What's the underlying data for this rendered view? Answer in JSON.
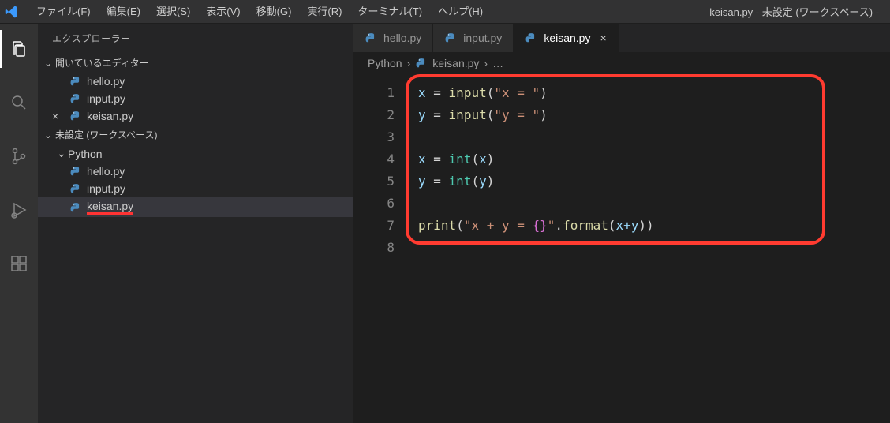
{
  "window_title": "keisan.py - 未設定 (ワークスペース) -",
  "menu": {
    "file": "ファイル(F)",
    "edit": "編集(E)",
    "select": "選択(S)",
    "view": "表示(V)",
    "go": "移動(G)",
    "run": "実行(R)",
    "terminal": "ターミナル(T)",
    "help": "ヘルプ(H)"
  },
  "sidebar": {
    "title": "エクスプローラー",
    "open_editors_label": "開いているエディター",
    "open_editors": [
      {
        "name": "hello.py"
      },
      {
        "name": "input.py"
      },
      {
        "name": "keisan.py",
        "active": true
      }
    ],
    "workspace_label": "未設定 (ワークスペース)",
    "folder": {
      "name": "Python",
      "files": [
        {
          "name": "hello.py"
        },
        {
          "name": "input.py"
        },
        {
          "name": "keisan.py",
          "selected": true
        }
      ]
    }
  },
  "tabs": [
    {
      "name": "hello.py"
    },
    {
      "name": "input.py"
    },
    {
      "name": "keisan.py",
      "active": true
    }
  ],
  "breadcrumb": {
    "part1": "Python",
    "part2": "keisan.py",
    "sep": "›",
    "ellipsis": "…"
  },
  "code": {
    "lines": [
      1,
      2,
      3,
      4,
      5,
      6,
      7,
      8
    ],
    "l1_var": "x",
    "l1_op": " = ",
    "l1_fn": "input",
    "l1_str": "\"x = \"",
    "l2_var": "y",
    "l2_op": " = ",
    "l2_fn": "input",
    "l2_str": "\"y = \"",
    "l4_var": "x",
    "l4_op": " = ",
    "l4_fn": "int",
    "l4_arg": "x",
    "l5_var": "y",
    "l5_op": " = ",
    "l5_fn": "int",
    "l5_arg": "y",
    "l7_fn": "print",
    "l7_str": "\"x + y = ",
    "l7_brace": "{}",
    "l7_str2": "\"",
    "l7_dot": ".",
    "l7_fmt": "format",
    "l7_expr": "x+y"
  }
}
